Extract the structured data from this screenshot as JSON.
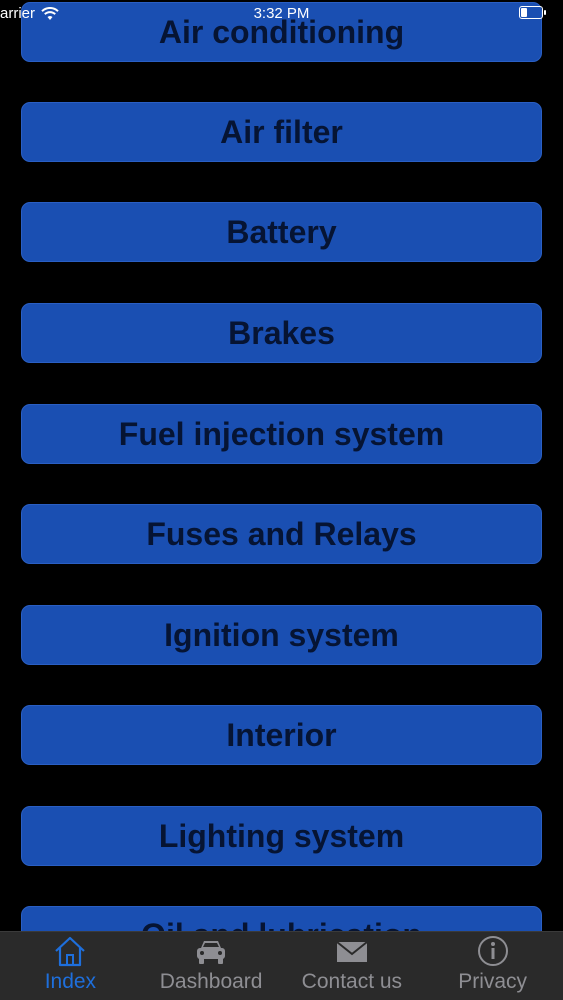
{
  "status_bar": {
    "carrier": "arrier",
    "time": "3:32 PM"
  },
  "menu_items": [
    "Air conditioning",
    "Air filter",
    "Battery",
    "Brakes",
    "Fuel injection system",
    "Fuses and Relays",
    "Ignition system",
    "Interior",
    "Lighting system",
    "Oil and lubrication"
  ],
  "tab_bar": {
    "tabs": [
      {
        "label": "Index",
        "icon": "home-icon",
        "active": true
      },
      {
        "label": "Dashboard",
        "icon": "car-icon",
        "active": false
      },
      {
        "label": "Contact us",
        "icon": "envelope-icon",
        "active": false
      },
      {
        "label": "Privacy",
        "icon": "info-icon",
        "active": false
      }
    ]
  },
  "colors": {
    "background": "#000000",
    "button_fill": "#1a4fb2",
    "button_text": "#061433",
    "tab_active": "#1e6fdc",
    "tab_inactive": "#8e8e93",
    "tab_bar_bg": "#2a2a2a"
  }
}
